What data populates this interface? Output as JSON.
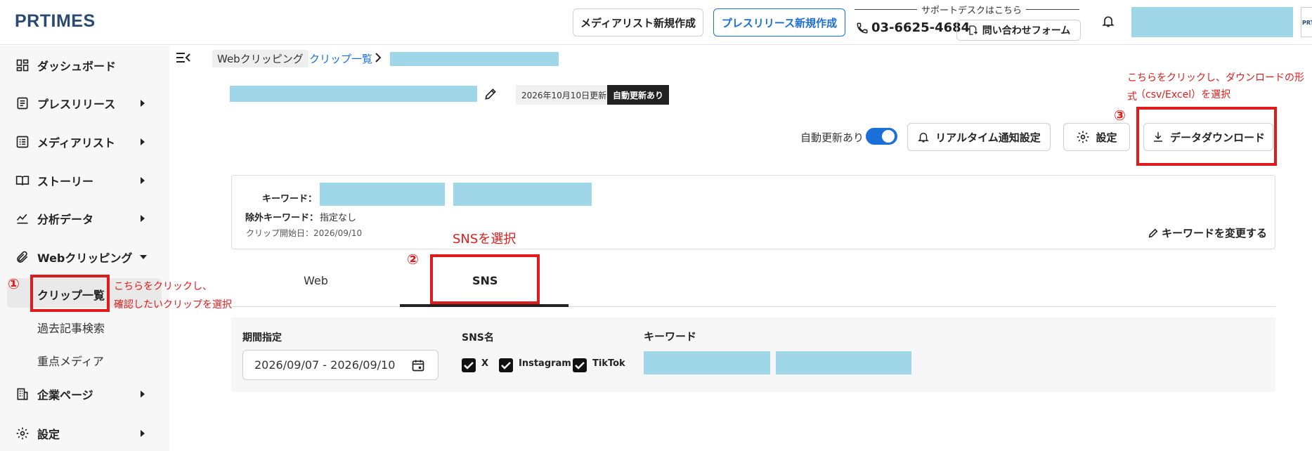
{
  "header": {
    "logo": "PRTIMES",
    "media_list_button": "メディアリスト新規作成",
    "press_release_button": "プレスリリース新規作成",
    "support_label": "サポートデスクはこちら",
    "phone": "03-6625-4684",
    "inquiry_button": "問い合わせフォーム",
    "account_edge_text": "PRT"
  },
  "sidebar": {
    "items": [
      {
        "label": "ダッシュボード",
        "icon": "dashboard-icon"
      },
      {
        "label": "プレスリリース",
        "icon": "document-icon"
      },
      {
        "label": "メディアリスト",
        "icon": "list-icon"
      },
      {
        "label": "ストーリー",
        "icon": "book-icon"
      },
      {
        "label": "分析データ",
        "icon": "chart-icon"
      },
      {
        "label": "Webクリッピング",
        "icon": "paperclip-icon"
      },
      {
        "label": "企業ページ",
        "icon": "building-icon"
      },
      {
        "label": "設定",
        "icon": "gear-icon"
      }
    ],
    "subitems": [
      "クリップ一覧",
      "過去記事検索",
      "重点メディア"
    ]
  },
  "breadcrumb": {
    "root": "Webクリッピング",
    "clip_list": "クリップ一覧"
  },
  "clip": {
    "updated": "2026年10月10日更新",
    "auto_badge": "自動更新あり"
  },
  "toolbar": {
    "auto_update_label": "自動更新あり",
    "realtime_button": "リアルタイム通知設定",
    "settings_button": "設定",
    "download_button": "データダウンロード"
  },
  "keywords": {
    "keyword_label": "キーワード：",
    "exclude_label": "除外キーワード：",
    "exclude_value": "指定なし",
    "clip_start": "クリップ開始日：2026/09/10",
    "change_button": "キーワードを変更する"
  },
  "tabs": {
    "web": "Web",
    "sns": "SNS"
  },
  "filters": {
    "period_label": "期間指定",
    "period_value": "2026/09/07 - 2026/09/10",
    "sns_label": "SNS名",
    "sns_options": [
      "X",
      "Instagram",
      "TikTok"
    ],
    "keyword_label": "キーワード"
  },
  "annotations": {
    "num1": "①",
    "step1_line1": "こちらをクリックし、",
    "step1_line2": "確認したいクリップを選択",
    "num2": "②",
    "step2": "SNSを選択",
    "num3": "③",
    "step3_line1": "こちらをクリックし、ダウンロードの形式",
    "step3_line2": "（csv/Excel）を選択",
    "accent_color": "#e01b1b"
  }
}
